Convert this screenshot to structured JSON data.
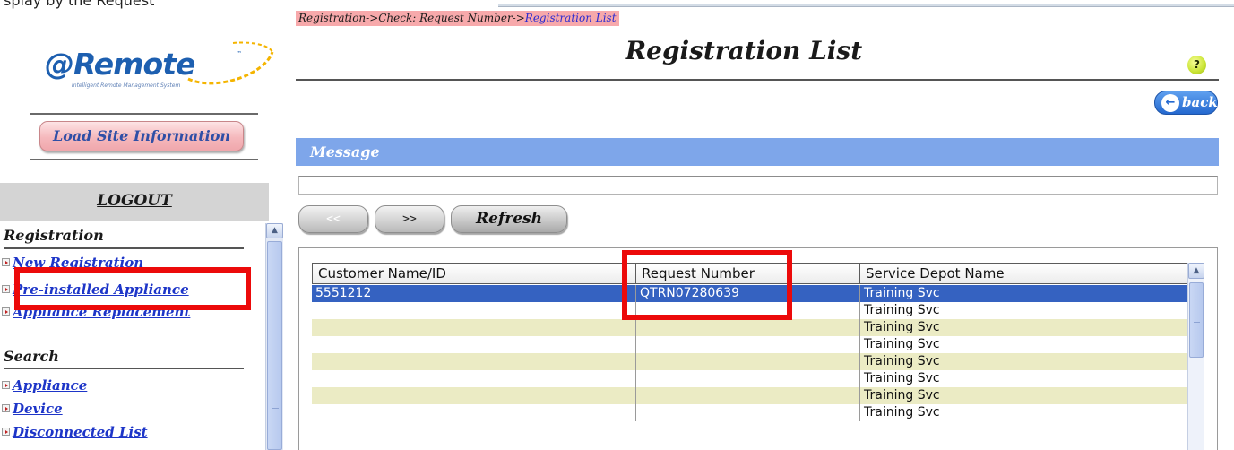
{
  "top_strip": {
    "text": "splay by the Request"
  },
  "sidebar": {
    "logo": {
      "text": "@Remote",
      "tm": "™",
      "tagline": "Intelligent Remote Management System"
    },
    "load_site_label": "Load Site Information",
    "logout_label": "LOGOUT",
    "registration": {
      "title": "Registration",
      "items": [
        {
          "label": "New Registration"
        },
        {
          "label": "Pre-installed Appliance"
        },
        {
          "label": "Appliance Replacement"
        }
      ]
    },
    "search": {
      "title": "Search",
      "items": [
        {
          "label": "Appliance"
        },
        {
          "label": "Device"
        },
        {
          "label": "Disconnected List"
        }
      ]
    }
  },
  "breadcrumb": {
    "path": "Registration->Check: Request Number->",
    "current": "Registration List"
  },
  "main": {
    "title": "Registration List",
    "help_label": "?",
    "back_label": "back",
    "message_label": "Message",
    "message_value": "",
    "prev_label": "<<",
    "next_label": ">>",
    "refresh_label": "Refresh"
  },
  "table": {
    "columns": [
      "Customer Name/ID",
      "Request Number",
      "Service Depot Name"
    ],
    "rows": [
      {
        "customer": "5551212",
        "request": "QTRN07280639",
        "depot": "Training Svc",
        "selected": true
      },
      {
        "customer": "",
        "request": "",
        "depot": "Training Svc"
      },
      {
        "customer": "",
        "request": "",
        "depot": "Training Svc"
      },
      {
        "customer": "",
        "request": "",
        "depot": "Training Svc"
      },
      {
        "customer": "",
        "request": "",
        "depot": "Training Svc"
      },
      {
        "customer": "",
        "request": "",
        "depot": "Training Svc"
      },
      {
        "customer": "",
        "request": "",
        "depot": "Training Svc"
      },
      {
        "customer": "",
        "request": "",
        "depot": "Training Svc"
      }
    ]
  },
  "colors": {
    "highlight_box": "#ec0a0a",
    "selected_row": "#3562c1",
    "alt_row": "#ebebc4",
    "message_bar": "#7ea6ea",
    "link": "#1d35c8"
  },
  "icons": {
    "scroll_up": "▲",
    "back_arrow": "←",
    "bullet": "▸"
  }
}
